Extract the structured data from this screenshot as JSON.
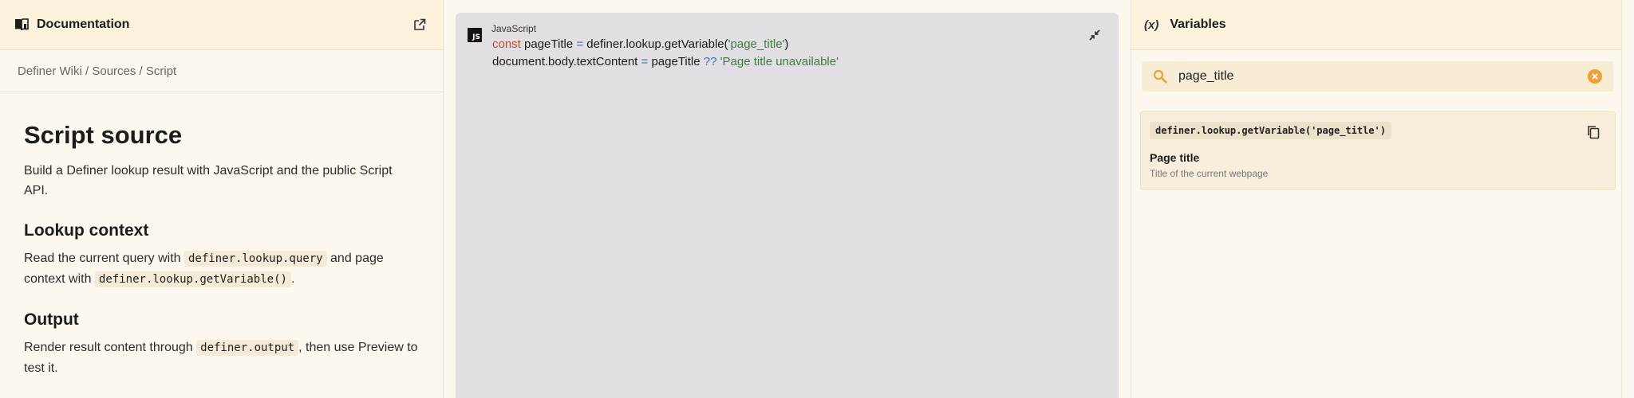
{
  "docs": {
    "header_title": "Documentation",
    "breadcrumb": "Definer Wiki / Sources / Script",
    "title": "Script source",
    "intro": "Build a Definer lookup result with JavaScript and the public Script API.",
    "section1": {
      "heading": "Lookup context",
      "text_before": "Read the current query with ",
      "code1": "definer.lookup.query",
      "text_middle": " and page context with ",
      "code2": "definer.lookup.getVariable()",
      "text_after": "."
    },
    "section2": {
      "heading": "Output",
      "text_before": "Render result content through ",
      "code1": "definer.output",
      "text_after": ", then use Preview to test it."
    }
  },
  "editor": {
    "badge": "JS",
    "language": "JavaScript",
    "line1": {
      "kw": "const",
      "var": " pageTitle ",
      "op": "=",
      "rest": " definer.lookup.getVariable(",
      "str": "'page_title'",
      "close": ")"
    },
    "line2": {
      "start": "document.body.textContent ",
      "op1": "=",
      "mid": " pageTitle ",
      "op2": "??",
      "sp": " ",
      "str": "'Page title unavailable'"
    }
  },
  "variables": {
    "header_icon": "(x)",
    "header_title": "Variables",
    "search": {
      "value": "page_title"
    },
    "items": [
      {
        "code": "definer.lookup.getVariable('page_title')",
        "name": "Page title",
        "description": "Title of the current webpage"
      }
    ]
  },
  "colors": {
    "accent": "#f0a030",
    "header_bg": "#fdf3dc",
    "panel_bg": "#fdf8ee",
    "editor_bg": "#e1dfe3"
  },
  "icons": [
    "book-icon",
    "open-external-icon",
    "collapse-icon",
    "variable-icon",
    "search-icon",
    "clear-icon",
    "copy-icon"
  ]
}
